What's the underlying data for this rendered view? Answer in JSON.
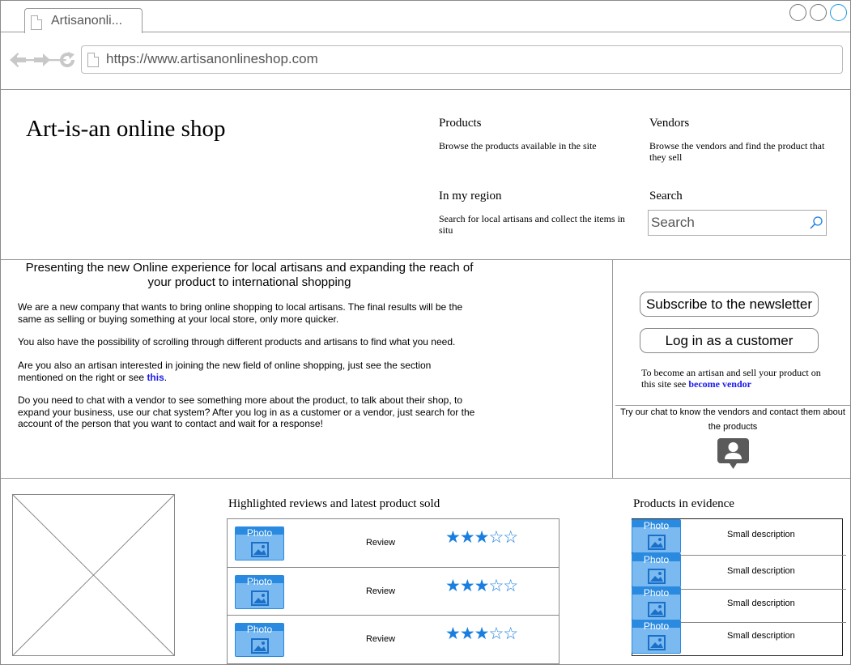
{
  "browser": {
    "tab_title": "Artisanonli...",
    "url": "https://www.artisanonlineshop.com"
  },
  "header": {
    "site_title": "Art-is-an online shop",
    "nav": {
      "products": {
        "title": "Products",
        "desc": "Browse the products available in the site"
      },
      "vendors": {
        "title": "Vendors",
        "desc": "Browse the vendors and find the product that they sell"
      },
      "region": {
        "title": "In my region",
        "desc": "Search for local artisans and collect the items in situ"
      },
      "search": {
        "title": "Search",
        "placeholder": "Search"
      }
    }
  },
  "intro": {
    "title": "Presenting the new Online experience for local artisans and expanding the reach of your product to international shopping",
    "p1": "We are a new company that wants to bring online shopping to local artisans. The final results will be the same as selling or buying something at your local store, only more quicker.",
    "p2": "You also have the possibility of scrolling through different products and artisans to find what you need.",
    "p3_text": "Are you also an artisan interested in joining the new field of online shopping, just see the section mentioned on the right or see ",
    "p3_link": "this",
    "p3_end": ".",
    "p4": "Do you need to chat with a vendor to see something more about the product, to talk about their shop, to expand your business, use our chat system? After you log in as a customer or a vendor, just search for the account of the person that you want to contact and wait for a response!"
  },
  "sidebar": {
    "subscribe_label": "Subscribe to the newsletter",
    "login_label": "Log in as a customer",
    "vendor_text": "To become an artisan and sell your product on this site see ",
    "vendor_link": "become vendor",
    "chat_text": "Try our chat to know the vendors and contact them about the products",
    "chat_icon": "contact-chat-icon"
  },
  "reviews": {
    "title": "Highlighted reviews and latest product sold",
    "rows": [
      {
        "photo": "Photo",
        "label": "Review",
        "stars": "★★★☆☆",
        "rating": 3
      },
      {
        "photo": "Photo",
        "label": "Review",
        "stars": "★★★☆☆",
        "rating": 3
      },
      {
        "photo": "Photo",
        "label": "Review",
        "stars": "★★★☆☆",
        "rating": 3
      }
    ]
  },
  "evidence": {
    "title": "Products in evidence",
    "items": [
      {
        "photo": "Photo",
        "desc": "Small description"
      },
      {
        "photo": "Photo",
        "desc": "Small description"
      },
      {
        "photo": "Photo",
        "desc": "Small description"
      },
      {
        "photo": "Photo",
        "desc": "Small description"
      }
    ]
  },
  "colors": {
    "accent": "#1a7ee0",
    "link": "#1a1aee",
    "border": "#9a9a9a"
  }
}
